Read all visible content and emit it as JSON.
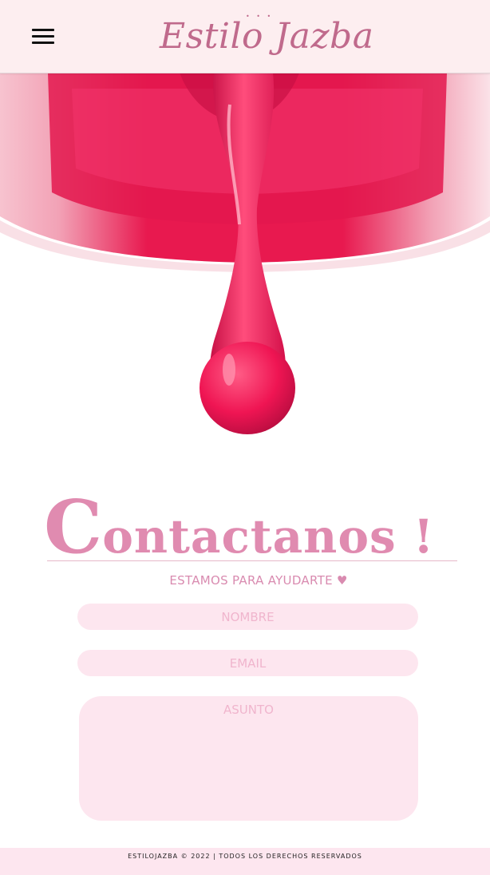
{
  "header": {
    "menu_icon": "hamburger-menu-icon",
    "logo_text": "Estilo Jazba",
    "logo_ornament": "• • •"
  },
  "hero": {
    "image": "pink nail polish drop",
    "colors": {
      "polish": "#f0195a",
      "polish_dark": "#c8104a",
      "polish_light": "#ff6d94"
    }
  },
  "contact": {
    "title_initial": "C",
    "title_rest": "ontactanos !",
    "subtitle": "ESTAMOS PARA AYUDARTE ♥",
    "fields": {
      "name_placeholder": "NOMBRE",
      "email_placeholder": "EMAIL",
      "subject_placeholder": "ASUNTO"
    },
    "accent_color": "#e08bb0",
    "field_color": "#fde6ef"
  },
  "footer": {
    "text": "ESTILOJAZBA © 2022 | TODOS LOS DERECHOS RESERVADOS"
  }
}
